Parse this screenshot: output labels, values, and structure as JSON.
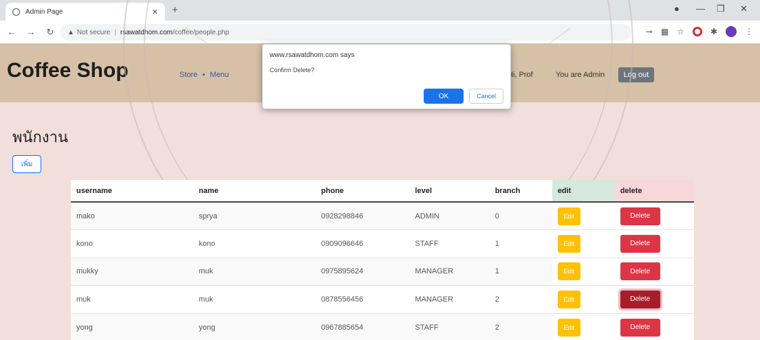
{
  "browser": {
    "tab_title": "Admin Page",
    "address_warning": "Not secure",
    "address_domain": "rsawatdhom.com",
    "address_path": "/coffee/people.php"
  },
  "navbar": {
    "brand": "Coffee Shop",
    "links": [
      "Store",
      "Menu"
    ],
    "user_text": "Hi, Prof",
    "role_text": "You are Admin",
    "logout_label": "Log out"
  },
  "dialog": {
    "title": "www.rsawatdhom.com says",
    "message": "Confirm Delete?",
    "ok_label": "OK",
    "cancel_label": "Cancel"
  },
  "page": {
    "title": "พนักงาน",
    "add_label": "เพิ่ม"
  },
  "table": {
    "headers": [
      "username",
      "name",
      "phone",
      "level",
      "branch",
      "edit",
      "delete"
    ],
    "edit_label": "Edit",
    "delete_label": "Delete",
    "rows": [
      [
        "mako",
        "sprya",
        "0928298846",
        "ADMIN",
        "0"
      ],
      [
        "kono",
        "kono",
        "0909096646",
        "STAFF",
        "1"
      ],
      [
        "mukky",
        "muk",
        "0975895624",
        "MANAGER",
        "1"
      ],
      [
        "muk",
        "muk",
        "0878556456",
        "MANAGER",
        "2"
      ],
      [
        "yong",
        "yong",
        "0967885654",
        "STAFF",
        "2"
      ]
    ]
  },
  "colors": {
    "navbar_bg": "#d6c1a6",
    "page_bg": "#f2dfdc",
    "edit_button": "#ffc107",
    "delete_button": "#dc3545",
    "dialog_ok": "#1a73e8"
  }
}
